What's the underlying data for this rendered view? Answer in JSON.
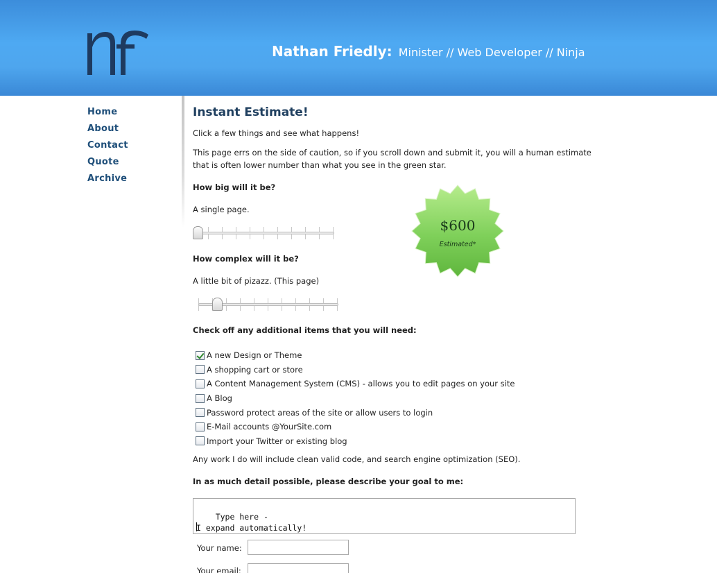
{
  "header": {
    "logo_alt": "nf",
    "name": "Nathan Friedly:",
    "roles": "Minister // Web Developer // Ninja"
  },
  "nav": [
    "Home",
    "About",
    "Contact",
    "Quote",
    "Archive"
  ],
  "main": {
    "title": "Instant Estimate!",
    "intro": "Click a few things and see what happens!",
    "caution_line1": "This page errs on the side of caution, so if you scroll down and submit it, you will a human estimate",
    "caution_line2": "that is often lower number than what you see in the green star.",
    "size_question": "How big will it be?",
    "size_answer": "A single page.",
    "size_level": 0,
    "complexity_question": "How complex will it be?",
    "complexity_answer": "A little bit of pizazz. (This page)",
    "complexity_level": 1,
    "slider_steps": 10,
    "addons_question": "Check off any additional items that you will need:",
    "addons": [
      {
        "label": "A new Design or Theme",
        "checked": true
      },
      {
        "label": "A shopping cart or store",
        "checked": false
      },
      {
        "label": "A Content Management System (CMS) - allows you to edit pages on your site",
        "checked": false
      },
      {
        "label": "A Blog",
        "checked": false
      },
      {
        "label": "Password protect areas of the site or allow users to login",
        "checked": false
      },
      {
        "label": "E-Mail accounts @YourSite.com",
        "checked": false
      },
      {
        "label": "Import your Twitter or existing blog",
        "checked": false
      }
    ],
    "seo_note": "Any work I do will include clean valid code, and search engine optimization (SEO).",
    "goal_question": "In as much detail possible, please describe your goal to me:",
    "goal_text": "Type here -\nI expand automatically!",
    "name_label": "Your name:",
    "email_label": "Your email:"
  },
  "estimate": {
    "price": "$600",
    "label": "Estimated*",
    "color": "#6cc24a"
  }
}
